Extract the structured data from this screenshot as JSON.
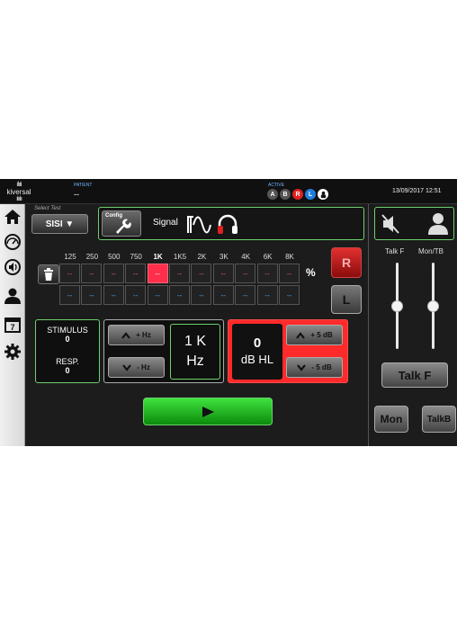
{
  "header": {
    "logo_text": "kiversal",
    "patient_label": "PATIENT",
    "patient_value": "--",
    "active_label": "ACTIVE",
    "active_indicators": [
      {
        "label": "A",
        "color": "#555555"
      },
      {
        "label": "B",
        "color": "#555555"
      },
      {
        "label": "R",
        "color": "#e02020"
      },
      {
        "label": "L",
        "color": "#1e7fe0"
      }
    ],
    "datetime": "13/09/2017 12:51"
  },
  "sidebar": {
    "items": [
      {
        "name": "home-icon"
      },
      {
        "name": "gauge-icon"
      },
      {
        "name": "audio-icon"
      },
      {
        "name": "patient-icon"
      },
      {
        "name": "calendar-icon",
        "label": "7"
      },
      {
        "name": "gear-icon"
      }
    ]
  },
  "test": {
    "select_label": "Select Test",
    "selected": "SISI ▼"
  },
  "config": {
    "button_label": "Config",
    "signal_label": "Signal"
  },
  "grid": {
    "frequencies": [
      "125",
      "250",
      "500",
      "750",
      "1K",
      "1K5",
      "2K",
      "3K",
      "4K",
      "6K",
      "8K"
    ],
    "active_index": 4,
    "right_values": [
      "--",
      "--",
      "--",
      "--",
      "--",
      "--",
      "--",
      "--",
      "--",
      "--",
      "--"
    ],
    "left_values": [
      "--",
      "--",
      "--",
      "--",
      "--",
      "--",
      "--",
      "--",
      "--",
      "--",
      "--"
    ],
    "unit": "%"
  },
  "ear_buttons": {
    "right": "R",
    "left": "L"
  },
  "stimulus": {
    "stimulus_label": "STIMULUS",
    "stimulus_value": "0",
    "resp_label": "RESP.",
    "resp_value": "0"
  },
  "frequency": {
    "up_label": "+ Hz",
    "down_label": "- Hz",
    "value": "1 K",
    "unit": "Hz"
  },
  "level": {
    "value": "0",
    "unit": "dB HL",
    "up_label": "+ 5 dB",
    "down_label": "- 5 dB"
  },
  "right_panel": {
    "talk_f_label": "Talk F",
    "mon_tb_label": "Mon/TB",
    "talk_f_slider": 0.5,
    "mon_tb_slider": 0.5,
    "talk_f_button": "Talk F",
    "mon_button": "Mon",
    "talkb_button": "TalkB"
  },
  "colors": {
    "accent_green": "#6cd06c",
    "alert_red": "#ff2a2a",
    "left_blue": "#4aa6ff"
  }
}
